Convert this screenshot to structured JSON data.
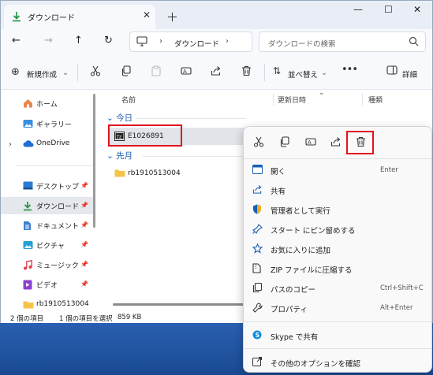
{
  "tab": {
    "title": "ダウンロード"
  },
  "address": {
    "location": "ダウンロード"
  },
  "search": {
    "placeholder": "ダウンロードの検索"
  },
  "toolbar": {
    "new_label": "新規作成",
    "sort_label": "並べ替え",
    "details_label": "詳細"
  },
  "sidebar": {
    "items": [
      {
        "label": "ホーム"
      },
      {
        "label": "ギャラリー"
      },
      {
        "label": "OneDrive"
      },
      {
        "label": "デスクトップ"
      },
      {
        "label": "ダウンロード"
      },
      {
        "label": "ドキュメント"
      },
      {
        "label": "ピクチャ"
      },
      {
        "label": "ミュージック"
      },
      {
        "label": "ビデオ"
      },
      {
        "label": "rb1910513004"
      }
    ]
  },
  "columns": {
    "name": "名前",
    "date": "更新日時",
    "type": "種類"
  },
  "groups": {
    "today": "今日",
    "last_month": "先月"
  },
  "files": [
    {
      "name": "E1026891",
      "badge": "7z"
    },
    {
      "name": "rb1910513004"
    }
  ],
  "status": {
    "count": "2 個の項目",
    "selected": "1 個の項目を選択",
    "size": "859 KB"
  },
  "context_menu": {
    "items": [
      {
        "label": "開く",
        "shortcut": "Enter"
      },
      {
        "label": "共有",
        "shortcut": ""
      },
      {
        "label": "管理者として実行",
        "shortcut": ""
      },
      {
        "label": "スタート にピン留めする",
        "shortcut": ""
      },
      {
        "label": "お気に入りに追加",
        "shortcut": ""
      },
      {
        "label": "ZIP ファイルに圧縮する",
        "shortcut": ""
      },
      {
        "label": "パスのコピー",
        "shortcut": "Ctrl+Shift+C"
      },
      {
        "label": "プロパティ",
        "shortcut": "Alt+Enter"
      },
      {
        "label": "Skype で共有",
        "shortcut": ""
      },
      {
        "label": "その他のオプションを確認",
        "shortcut": ""
      }
    ]
  },
  "colors": {
    "accent": "#1a5fb4",
    "highlight": "#e0141e",
    "folder": "#f4c34a"
  }
}
